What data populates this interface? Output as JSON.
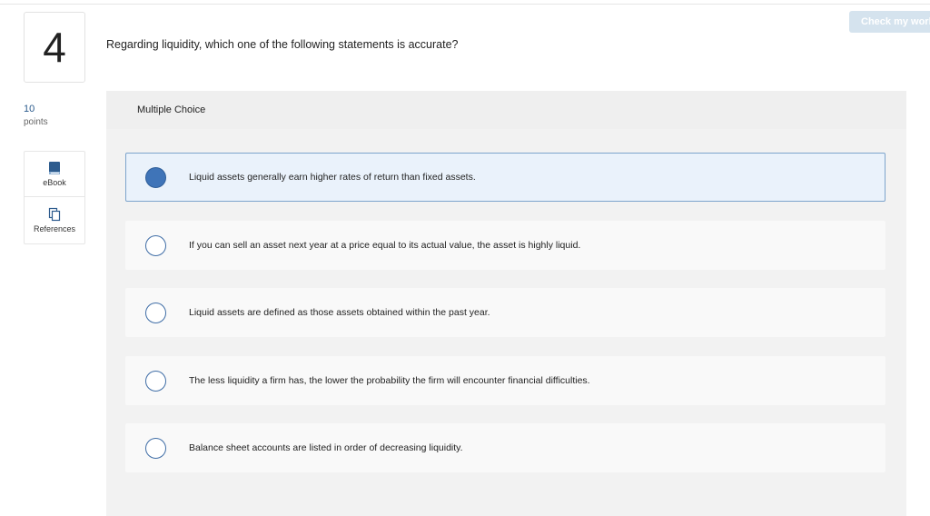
{
  "toolbar": {
    "check_label": "Check my work"
  },
  "question": {
    "number": "4",
    "text": "Regarding liquidity, which one of the following statements is accurate?",
    "points_value": "10",
    "points_label": "points"
  },
  "tools": [
    {
      "label": "eBook",
      "icon": "book-icon"
    },
    {
      "label": "References",
      "icon": "copy-icon"
    }
  ],
  "panel": {
    "title": "Multiple Choice",
    "options": [
      {
        "text": "Liquid assets generally earn higher rates of return than fixed assets.",
        "selected": true
      },
      {
        "text": "If you can sell an asset next year at a price equal to its actual value, the asset is highly liquid.",
        "selected": false
      },
      {
        "text": "Liquid assets are defined as those assets obtained within the past year.",
        "selected": false
      },
      {
        "text": "The less liquidity a firm has, the lower the probability the firm will encounter financial difficulties.",
        "selected": false
      },
      {
        "text": "Balance sheet accounts are listed in order of decreasing liquidity.",
        "selected": false
      }
    ]
  },
  "colors": {
    "accent": "#3f74b8",
    "selected_bg": "#eaf2fb",
    "points": "#2a5a8c"
  }
}
